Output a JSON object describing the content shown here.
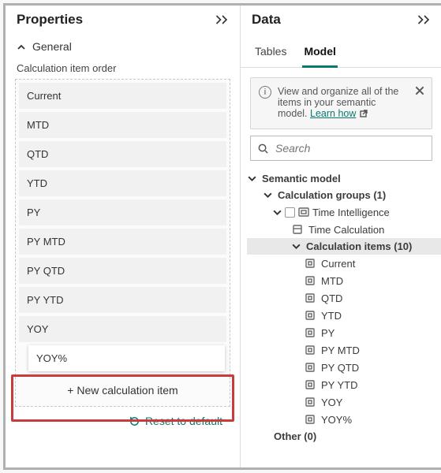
{
  "properties": {
    "title": "Properties",
    "sections": {
      "general": "General"
    },
    "calc_order_label": "Calculation item order",
    "items": [
      "Current",
      "MTD",
      "QTD",
      "YTD",
      "PY",
      "PY MTD",
      "PY QTD",
      "PY YTD",
      "YOY"
    ],
    "new_entry": "YOY%",
    "new_item_btn": "+ New calculation item",
    "reset": "Reset to default"
  },
  "data": {
    "title": "Data",
    "tabs": {
      "tables": "Tables",
      "model": "Model"
    },
    "info_text": "View and organize all of the items in your semantic model. ",
    "learn": "Learn how",
    "search_placeholder": "Search",
    "tree": {
      "root": "Semantic model",
      "calc_groups": "Calculation groups (1)",
      "time_intel": "Time Intelligence",
      "time_calc": "Time Calculation",
      "calc_items": "Calculation items (10)",
      "leaves": [
        "Current",
        "MTD",
        "QTD",
        "YTD",
        "PY",
        "PY MTD",
        "PY QTD",
        "PY YTD",
        "YOY",
        "YOY%"
      ],
      "other": "Other (0)"
    }
  }
}
